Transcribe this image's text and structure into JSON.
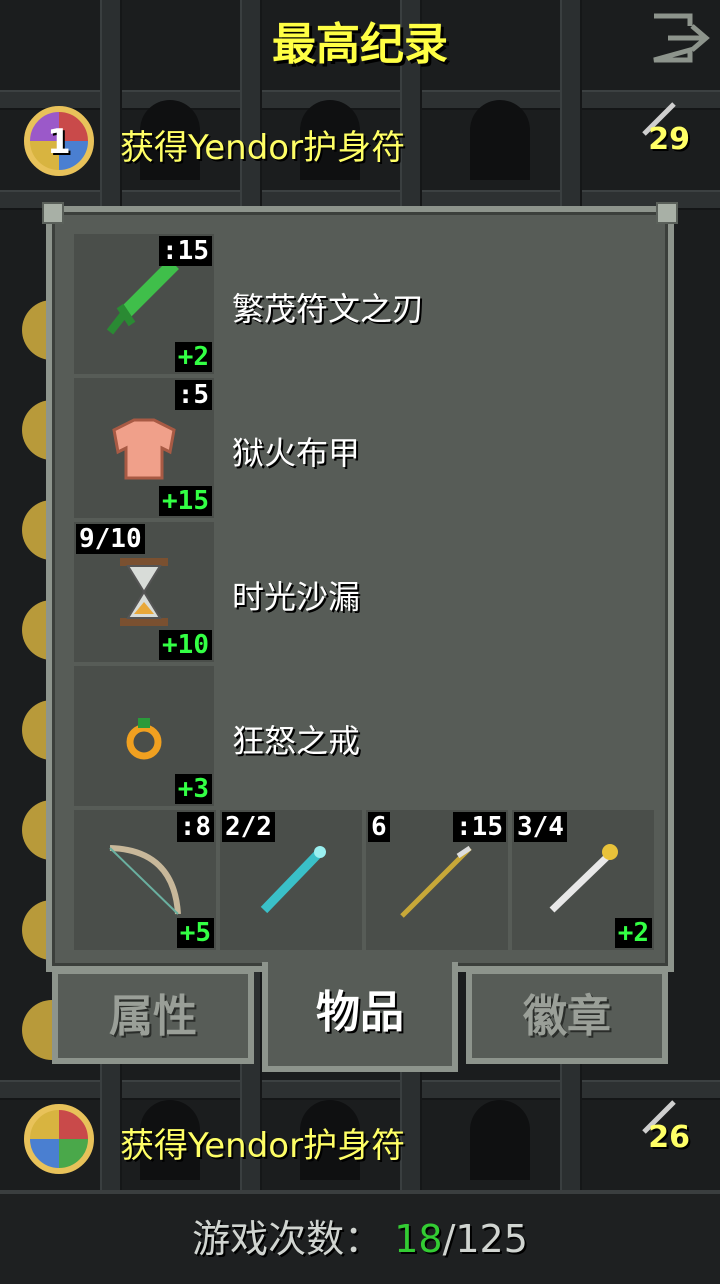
{
  "header": {
    "title": "最高纪录"
  },
  "records": [
    {
      "rank": "1",
      "text": "获得Yendor护身符",
      "score": "29"
    },
    {
      "rank": "",
      "text": "获得Yendor护身符",
      "score": "26"
    }
  ],
  "window": {
    "items": [
      {
        "name": "繁茂符文之刃",
        "top_tag": ":15",
        "bottom_tag": "+2",
        "icon": "green-sword-icon"
      },
      {
        "name": "狱火布甲",
        "top_tag": ":5",
        "bottom_tag": "+15",
        "icon": "cloth-armor-icon"
      },
      {
        "name": "时光沙漏",
        "top_tag": "9/10",
        "bottom_tag": "+10",
        "icon": "hourglass-icon"
      },
      {
        "name": "狂怒之戒",
        "top_tag": "",
        "bottom_tag": "+3",
        "icon": "ring-icon"
      }
    ],
    "quickslots": [
      {
        "top_left": "",
        "top_right": ":8",
        "bottom": "+5",
        "icon": "bow-icon"
      },
      {
        "top_left": "2/2",
        "top_right": "",
        "bottom": "",
        "icon": "wand-icon"
      },
      {
        "top_left": "6",
        "top_right": ":15",
        "bottom": "",
        "icon": "spear-icon"
      },
      {
        "top_left": "3/4",
        "top_right": "",
        "bottom": "+2",
        "icon": "staff-icon"
      }
    ]
  },
  "tabs": {
    "stats": "属性",
    "items": "物品",
    "badges": "徽章"
  },
  "footer": {
    "label": "游戏次数：",
    "count": "18",
    "total": "/125"
  },
  "colors": {
    "title": "#ffff44",
    "bonus": "#33ff44",
    "count": "#33cc33"
  }
}
